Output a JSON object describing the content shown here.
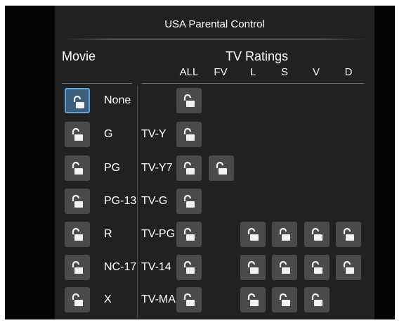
{
  "title": "USA Parental Control",
  "movie": {
    "heading": "Movie",
    "ratings": [
      "None",
      "G",
      "PG",
      "PG-13",
      "R",
      "NC-17",
      "X"
    ]
  },
  "tv": {
    "heading": "TV Ratings",
    "columns": [
      "ALL",
      "FV",
      "L",
      "S",
      "V",
      "D"
    ],
    "ratings": [
      "TV-Y",
      "TV-Y7",
      "TV-G",
      "TV-PG",
      "TV-14",
      "TV-MA"
    ]
  },
  "icons": {
    "lock": "unlocked-padlock-icon"
  },
  "colors": {
    "panel": "#212121",
    "lock_button": "#4a4a4a",
    "focus_fill": "#3c5f7e",
    "focus_border": "#5ea3d6"
  }
}
